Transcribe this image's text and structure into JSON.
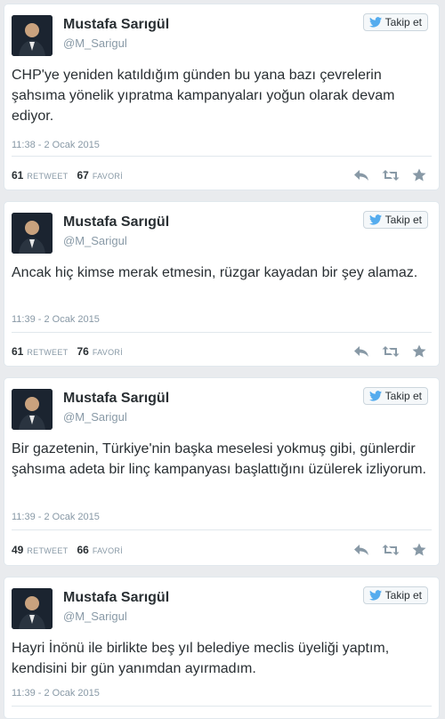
{
  "tweets": [
    {
      "name": "Mustafa Sarıgül",
      "handle": "@M_Sarigul",
      "follow_label": "Takip et",
      "text": "CHP'ye yeniden katıldığım günden bu yana bazı çevrelerin şahsıma yönelik yıpratma kampanyaları yoğun olarak devam ediyor.",
      "time": "11:38 - 2 Ocak 2015",
      "retweets": "61",
      "retweet_label": "RETWEET",
      "favorites": "67",
      "favorite_label": "FAVORİ"
    },
    {
      "name": "Mustafa Sarıgül",
      "handle": "@M_Sarigul",
      "follow_label": "Takip et",
      "text": "Ancak hiç kimse merak etmesin, rüzgar kayadan bir şey alamaz.",
      "time": "11:39 - 2 Ocak 2015",
      "retweets": "61",
      "retweet_label": "RETWEET",
      "favorites": "76",
      "favorite_label": "FAVORİ"
    },
    {
      "name": "Mustafa Sarıgül",
      "handle": "@M_Sarigul",
      "follow_label": "Takip et",
      "text": "Bir gazetenin, Türkiye'nin başka meselesi yokmuş gibi, günlerdir şahsıma adeta bir linç kampanyası başlattığını üzülerek izliyorum.",
      "time": "11:39 - 2 Ocak 2015",
      "retweets": "49",
      "retweet_label": "RETWEET",
      "favorites": "66",
      "favorite_label": "FAVORİ"
    },
    {
      "name": "Mustafa Sarıgül",
      "handle": "@M_Sarigul",
      "follow_label": "Takip et",
      "text": "Hayri İnönü ile birlikte beş yıl belediye meclis üyeliği yaptım, kendisini bir gün yanımdan ayırmadım.",
      "time": "11:39 - 2 Ocak 2015"
    }
  ],
  "colors": {
    "twitter_blue": "#55acee",
    "action_gray": "#8899a6",
    "background": "#e9ebee"
  },
  "icons": {
    "follow": "twitter-bird-icon",
    "reply": "reply-icon",
    "retweet": "retweet-icon",
    "favorite": "star-icon"
  }
}
